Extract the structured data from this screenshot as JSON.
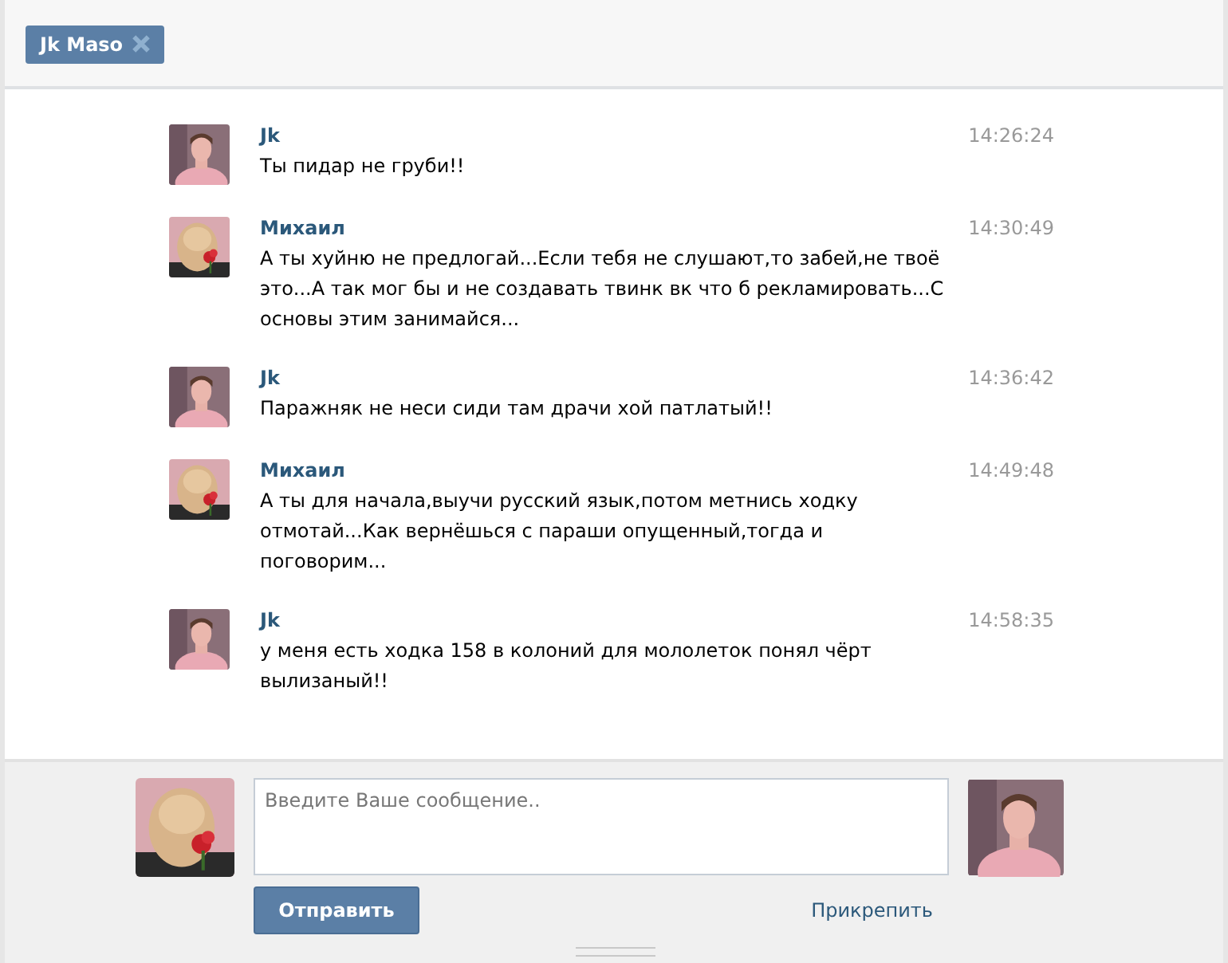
{
  "tabs": [
    {
      "label": "Jk Maso",
      "selected": true
    }
  ],
  "messages": [
    {
      "author": "Jk",
      "time": "14:26:24",
      "text": "Ты пидар не груби!!"
    },
    {
      "author": "Михаил",
      "time": "14:30:49",
      "text": "А ты хуйню не предлогай...Если тебя не слушают,то забей,не твоё это...А так мог бы и не создавать твинк вк что б рекламировать...С основы этим занимайся..."
    },
    {
      "author": "Jk",
      "time": "14:36:42",
      "text": "Паражняк не неси сиди там драчи хой патлатый!!"
    },
    {
      "author": "Михаил",
      "time": "14:49:48",
      "text": "А ты для начала,выучи русский язык,потом метнись ходку отмотай...Как вернёшься с параши опущенный,тогда и поговорим..."
    },
    {
      "author": "Jk",
      "time": "14:58:35",
      "text": "у меня есть ходка 158 в колоний для мололеток понял чёрт вылизаный!!"
    }
  ],
  "composer": {
    "placeholder": "Введите Ваше сообщение..",
    "send_button": "Отправить",
    "attach_link": "Прикрепить"
  }
}
